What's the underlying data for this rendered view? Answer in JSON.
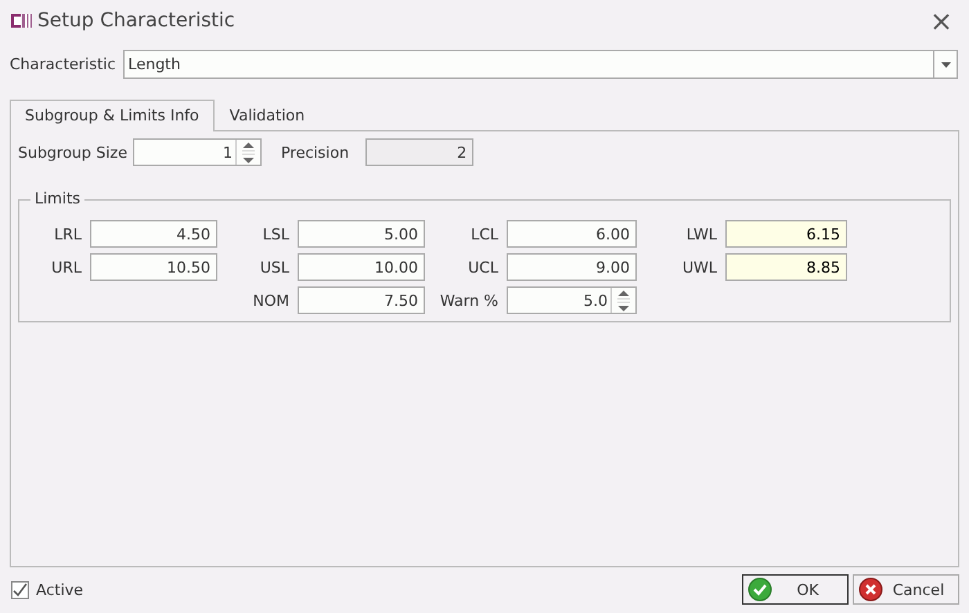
{
  "window": {
    "title": "Setup Characteristic",
    "close": "×"
  },
  "characteristic": {
    "label": "Characteristic",
    "value": "Length"
  },
  "tabs": [
    {
      "label": "Subgroup & Limits Info",
      "selected": true
    },
    {
      "label": "Validation",
      "selected": false
    }
  ],
  "subgroup": [
    {
      "label": "Subgroup Size",
      "value": "1",
      "kind": "spin",
      "disabled": false
    },
    {
      "label": "Precision",
      "value": "2",
      "kind": "text",
      "disabled": true
    }
  ],
  "limits": {
    "title": "Limits",
    "columns": [
      {
        "fields": [
          {
            "label": "LRL",
            "value": "4.50",
            "kind": "text",
            "highlighted": false
          },
          {
            "label": "URL",
            "value": "10.50",
            "kind": "text",
            "highlighted": false
          }
        ]
      },
      {
        "fields": [
          {
            "label": "LSL",
            "value": "5.00",
            "kind": "text",
            "highlighted": false
          },
          {
            "label": "USL",
            "value": "10.00",
            "kind": "text",
            "highlighted": false
          },
          {
            "label": "NOM",
            "value": "7.50",
            "kind": "text",
            "highlighted": false
          }
        ]
      },
      {
        "fields": [
          {
            "label": "LCL",
            "value": "6.00",
            "kind": "text",
            "highlighted": false
          },
          {
            "label": "UCL",
            "value": "9.00",
            "kind": "text",
            "highlighted": false
          },
          {
            "label": "Warn %",
            "value": "5.0",
            "kind": "spin",
            "highlighted": false
          }
        ]
      },
      {
        "fields": [
          {
            "label": "LWL",
            "value": "6.15",
            "kind": "text",
            "highlighted": true
          },
          {
            "label": "UWL",
            "value": "8.85",
            "kind": "text",
            "highlighted": true
          }
        ]
      }
    ]
  },
  "active": {
    "label": "Active",
    "checked": true
  },
  "buttons": [
    {
      "label": "OK",
      "kind": "ok",
      "focused": true
    },
    {
      "label": "Cancel",
      "kind": "cancel",
      "focused": false
    }
  ]
}
